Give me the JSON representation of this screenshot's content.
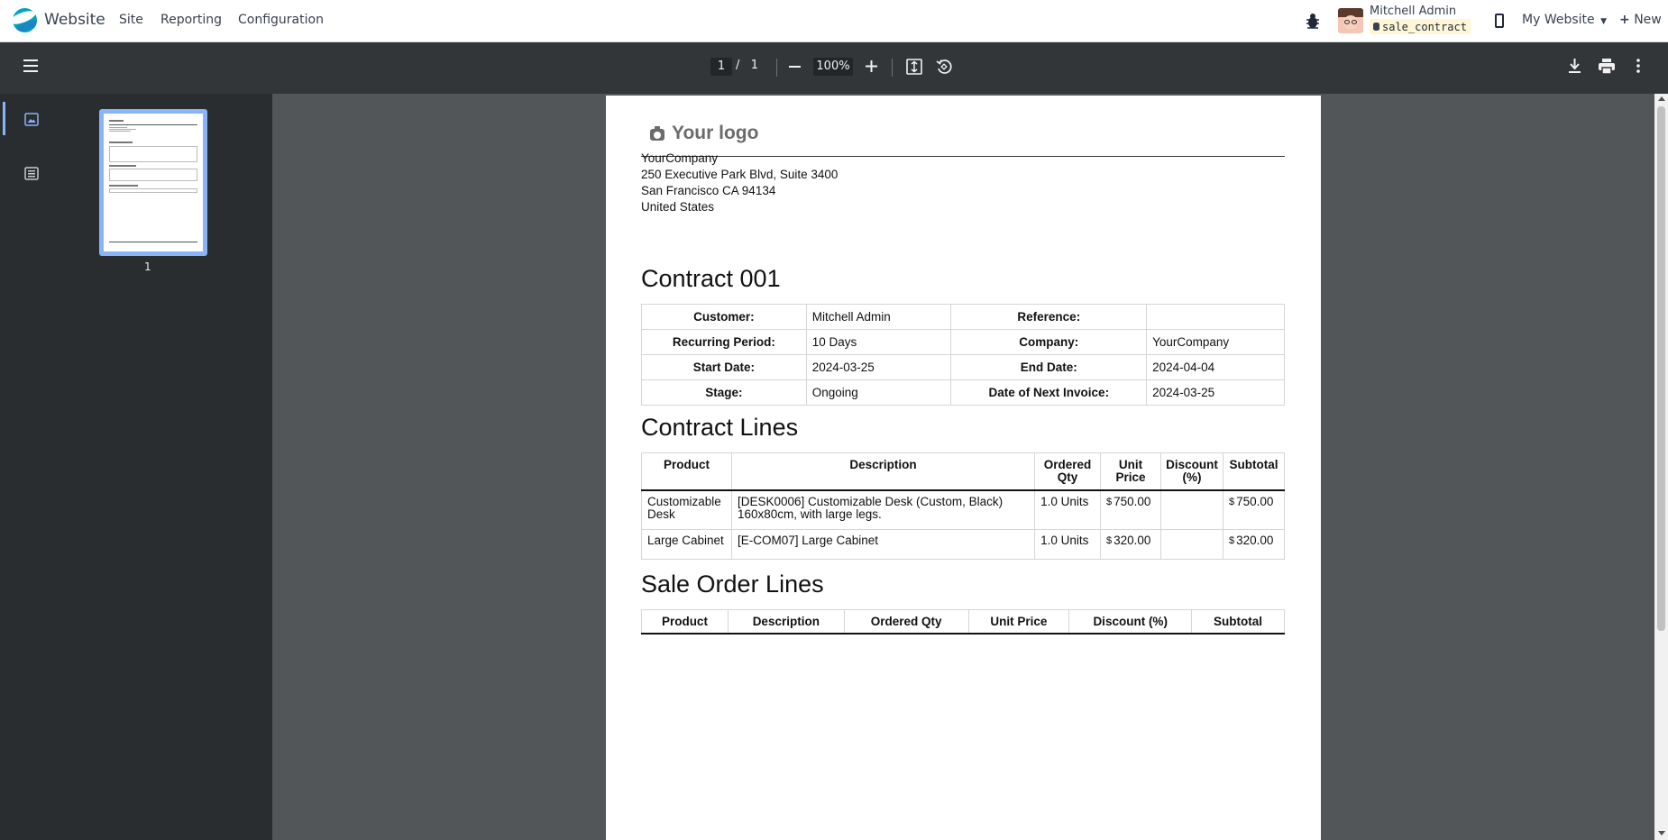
{
  "navbar": {
    "app_name": "Website",
    "menu": [
      "Site",
      "Reporting",
      "Configuration"
    ],
    "user_name": "Mitchell Admin",
    "database": "sale_contract",
    "website_selector": "My Website",
    "new_label": "New",
    "icons": [
      "app-logo",
      "bug-icon",
      "avatar",
      "mobile-icon",
      "caret-down-icon",
      "plus-icon"
    ]
  },
  "pdf_toolbar": {
    "current_page": "1",
    "page_separator": "/",
    "total_pages": "1",
    "zoom": "100%",
    "icons": [
      "menu-icon",
      "zoom-out-icon",
      "zoom-in-icon",
      "fit-page-icon",
      "rotate-icon",
      "download-icon",
      "print-icon",
      "more-icon"
    ]
  },
  "sidebar": {
    "thumbnail_label": "1",
    "icons": [
      "thumbnail-view-icon",
      "outline-view-icon"
    ]
  },
  "document": {
    "logo_text": "Your logo",
    "company_address": [
      "YourCompany",
      "250 Executive Park Blvd, Suite 3400",
      "San Francisco CA 94134",
      "United States"
    ],
    "title": "Contract 001",
    "info": {
      "customer_label": "Customer:",
      "customer": "Mitchell Admin",
      "reference_label": "Reference:",
      "reference": "",
      "period_label": "Recurring Period:",
      "period": "10 Days",
      "company_label": "Company:",
      "company": "YourCompany",
      "start_label": "Start Date:",
      "start": "2024-03-25",
      "end_label": "End Date:",
      "end": "2024-04-04",
      "stage_label": "Stage:",
      "stage": "Ongoing",
      "next_invoice_label": "Date of Next Invoice:",
      "next_invoice": "2024-03-25"
    },
    "contract_lines_title": "Contract Lines",
    "contract_lines_headers": {
      "product": "Product",
      "description": "Description",
      "ordered_qty_1": "Ordered",
      "ordered_qty_2": "Qty",
      "unit_price_1": "Unit",
      "unit_price_2": "Price",
      "discount_1": "Discount",
      "discount_2": "(%)",
      "subtotal": "Subtotal"
    },
    "contract_lines": [
      {
        "product_1": "Customizable",
        "product_2": "Desk",
        "description_1": "[DESK0006] Customizable Desk (Custom, Black)",
        "description_2": "160x80cm, with large legs.",
        "qty": "1.0 Units",
        "currency": "$",
        "unit_price": "750.00",
        "discount": "",
        "subtotal": "750.00"
      },
      {
        "product_1": "Large Cabinet",
        "product_2": "",
        "description_1": "[E-COM07] Large Cabinet",
        "description_2": "",
        "qty": "1.0 Units",
        "currency": "$",
        "unit_price": "320.00",
        "discount": "",
        "subtotal": "320.00"
      }
    ],
    "sale_order_lines_title": "Sale Order Lines",
    "sale_order_headers": [
      "Product",
      "Description",
      "Ordered Qty",
      "Unit Price",
      "Discount (%)",
      "Subtotal"
    ]
  }
}
